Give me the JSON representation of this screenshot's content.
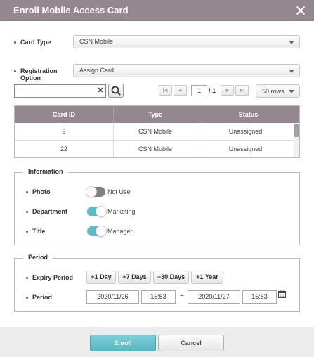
{
  "dialog": {
    "title": "Enroll Mobile Access Card"
  },
  "card_type": {
    "label": "Card Type",
    "value": "CSN Mobile"
  },
  "registration": {
    "label_line1": "Registration",
    "label_line2": "Option",
    "value": "Assign Card"
  },
  "search": {
    "value": "",
    "clear_label": "✕"
  },
  "pagination": {
    "current_page": "1",
    "total": "/ 1",
    "rows_per_page": "50 rows"
  },
  "table": {
    "headers": [
      "Card ID",
      "Type",
      "Status"
    ],
    "rows": [
      {
        "card_id": "9",
        "type": "CSN Mobile",
        "status": "Unassigned"
      },
      {
        "card_id": "22",
        "type": "CSN Mobile",
        "status": "Unassigned"
      }
    ]
  },
  "information": {
    "legend": "Information",
    "photo": {
      "label": "Photo",
      "state": "off",
      "text": "Not Use"
    },
    "department": {
      "label": "Department",
      "state": "on",
      "text": "Marketing"
    },
    "title": {
      "label": "Title",
      "state": "on",
      "text": "Manager"
    }
  },
  "period": {
    "legend": "Period",
    "expiry_label": "Expiry Period",
    "presets": [
      "+1 Day",
      "+7 Days",
      "+30 Days",
      "+1 Year"
    ],
    "period_label": "Period",
    "start_date": "2020/11/26",
    "start_time": "15:53",
    "separator": "~",
    "end_date": "2020/11/27",
    "end_time": "15:53"
  },
  "footer": {
    "enroll_label": "Enroll",
    "cancel_label": "Cancel"
  },
  "colors": {
    "header": "#958790",
    "accent": "#5bbcc8"
  },
  "icons": [
    "close-icon",
    "search-icon",
    "first-page-icon",
    "prev-page-icon",
    "next-page-icon",
    "last-page-icon",
    "calendar-icon"
  ]
}
